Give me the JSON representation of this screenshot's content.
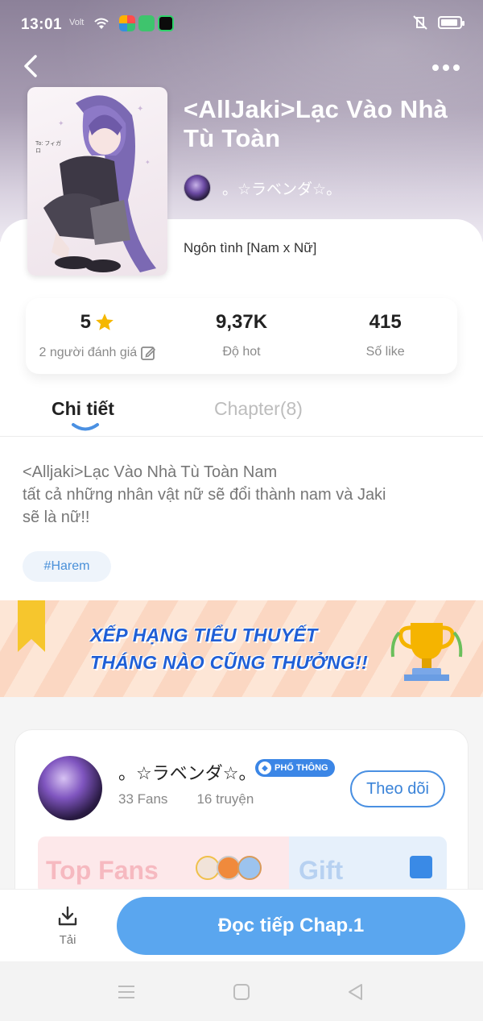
{
  "status_bar": {
    "time": "13:01",
    "signal": "Volt"
  },
  "book": {
    "title": "<AllJaki>Lạc Vào Nhà Tù Toàn",
    "author_name": "。☆ラベンダ☆。",
    "genre": "Ngôn tình [Nam x Nữ]",
    "cover_caption": "To: フィガロ"
  },
  "stats": {
    "rating": "5",
    "rating_label": "2 người đánh giá",
    "hot": "9,37K",
    "hot_label": "Độ hot",
    "likes": "415",
    "likes_label": "Số like"
  },
  "tabs": {
    "detail": "Chi tiết",
    "chapters": "Chapter(8)"
  },
  "description": {
    "line1": "<Alljaki>Lạc Vào Nhà Tù Toàn Nam",
    "line2": "tất cả những nhân vật nữ sẽ đổi thành nam và Jaki",
    "line3": "sẽ là nữ!!"
  },
  "tag": "#Harem",
  "banner": {
    "line1": "XẾP HẠNG TIỂU THUYẾT",
    "line2": "THÁNG NÀO CŨNG THƯỞNG!!"
  },
  "author_card": {
    "name": "。☆ラベンダ☆。",
    "badge": "PHỔ THÔNG",
    "fans": "33 Fans",
    "stories": "16 truyện",
    "follow": "Theo dõi",
    "top_fans": "Top Fans",
    "gift": "Gift"
  },
  "actions": {
    "download": "Tải",
    "read": "Đọc tiếp Chap.1"
  },
  "colors": {
    "accent": "#5aa6ef",
    "follow_border": "#4a90e2",
    "star": "#f5b700",
    "banner_text": "#1f5fd6"
  }
}
